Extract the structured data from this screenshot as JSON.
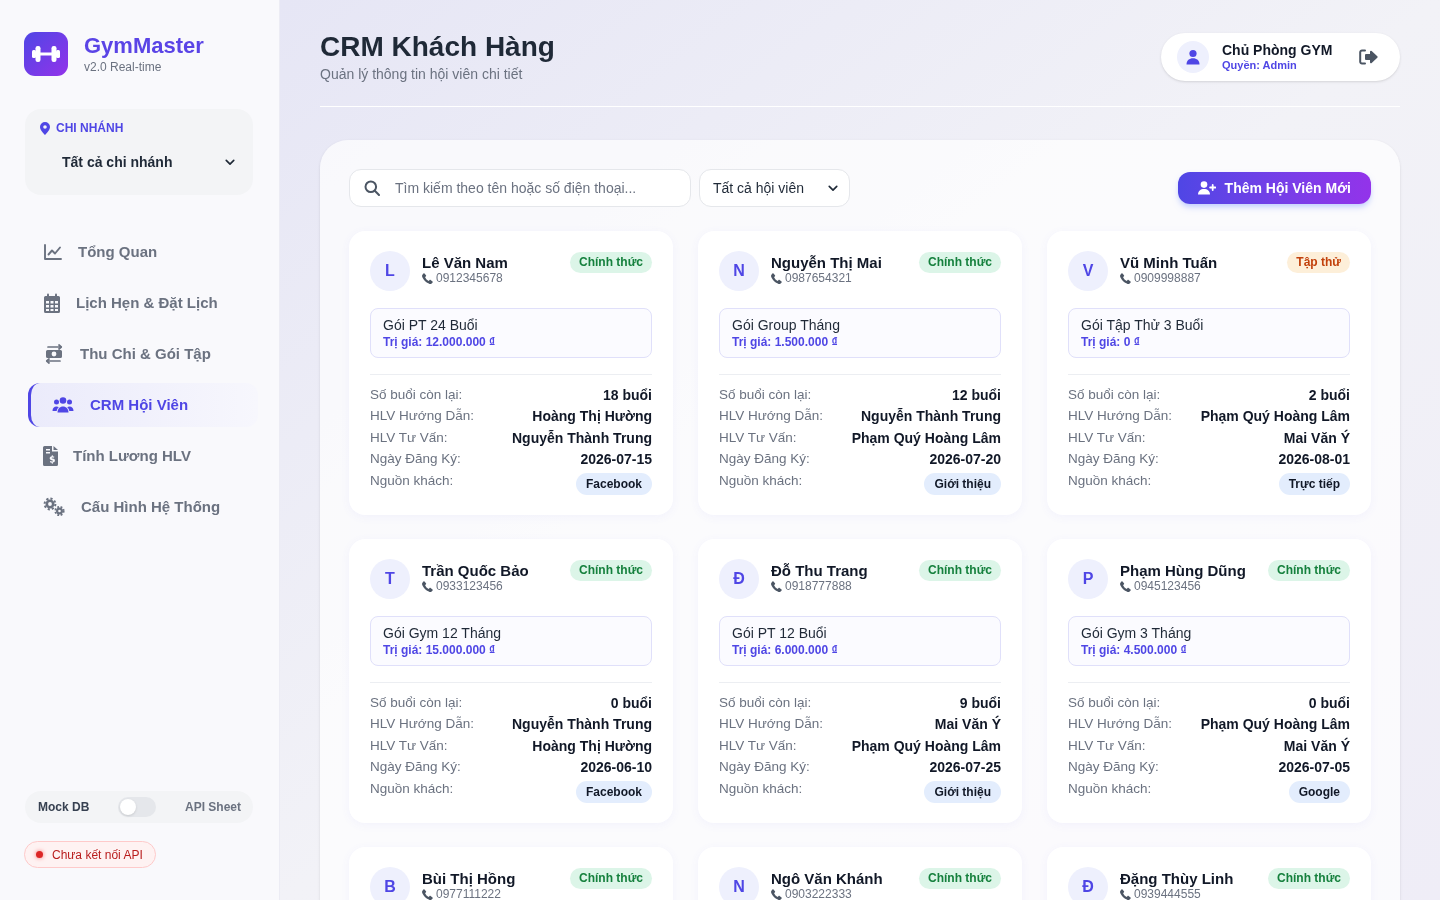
{
  "sidebar": {
    "logo": {
      "title": "GymMaster",
      "subtitle": "v2.0 Real-time"
    },
    "branch": {
      "label": "CHI NHÁNH",
      "value": "Tất cả chi nhánh"
    },
    "nav": [
      {
        "label": "Tổng Quan",
        "selected": false
      },
      {
        "label": "Lịch Hẹn & Đặt Lịch",
        "selected": false
      },
      {
        "label": "Thu Chi & Gói Tập",
        "selected": false
      },
      {
        "label": "CRM Hội Viên",
        "selected": true
      },
      {
        "label": "Tính Lương HLV",
        "selected": false
      },
      {
        "label": "Cấu Hình Hệ Thống",
        "selected": false
      }
    ],
    "data_source": {
      "left_label": "Mock DB",
      "right_label": "API Sheet",
      "on": false
    },
    "connection_status": "Chưa kết nối API"
  },
  "header": {
    "title": "CRM Khách Hàng",
    "subtitle": "Quản lý thông tin hội viên chi tiết",
    "user": {
      "name": "Chủ Phòng GYM",
      "role": "Quyền: Admin"
    }
  },
  "toolbar": {
    "search": {
      "placeholder": "Tìm kiếm theo tên hoặc số điện thoại..."
    },
    "filter": {
      "value": "Tất cả hội viên"
    },
    "add_button": "Thêm Hội Viên Mới"
  },
  "members": [
    {
      "initial": "L",
      "name": "Lê Văn Nam",
      "phone": "0912345678",
      "status": {
        "label": "Chính thức",
        "kind": "official"
      },
      "package": {
        "name": "Gói PT 24 Buổi",
        "price": "Trị giá: 12.000.000 ₫"
      },
      "details": [
        {
          "label": "Số buổi còn lại:",
          "value": "18 buổi"
        },
        {
          "label": "HLV Hướng Dẫn:",
          "value": "Hoàng Thị Hường"
        },
        {
          "label": "HLV Tư Vấn:",
          "value": "Nguyễn Thành Trung"
        },
        {
          "label": "Ngày Đăng Ký:",
          "value": "2026-07-15"
        }
      ],
      "source": {
        "label": "Nguồn khách:",
        "value": "Facebook"
      }
    },
    {
      "initial": "N",
      "name": "Nguyễn Thị Mai",
      "phone": "0987654321",
      "status": {
        "label": "Chính thức",
        "kind": "official"
      },
      "package": {
        "name": "Gói Group Tháng",
        "price": "Trị giá: 1.500.000 ₫"
      },
      "details": [
        {
          "label": "Số buổi còn lại:",
          "value": "12 buổi"
        },
        {
          "label": "HLV Hướng Dẫn:",
          "value": "Nguyễn Thành Trung"
        },
        {
          "label": "HLV Tư Vấn:",
          "value": "Phạm Quý Hoàng Lâm"
        },
        {
          "label": "Ngày Đăng Ký:",
          "value": "2026-07-20"
        }
      ],
      "source": {
        "label": "Nguồn khách:",
        "value": "Giới thiệu"
      }
    },
    {
      "initial": "V",
      "name": "Vũ Minh Tuấn",
      "phone": "0909998887",
      "status": {
        "label": "Tập thử",
        "kind": "trial"
      },
      "package": {
        "name": "Gói Tập Thử 3 Buổi",
        "price": "Trị giá: 0 ₫"
      },
      "details": [
        {
          "label": "Số buổi còn lại:",
          "value": "2 buổi"
        },
        {
          "label": "HLV Hướng Dẫn:",
          "value": "Phạm Quý Hoàng Lâm"
        },
        {
          "label": "HLV Tư Vấn:",
          "value": "Mai Văn Ý"
        },
        {
          "label": "Ngày Đăng Ký:",
          "value": "2026-08-01"
        }
      ],
      "source": {
        "label": "Nguồn khách:",
        "value": "Trực tiếp"
      }
    },
    {
      "initial": "T",
      "name": "Trần Quốc Bảo",
      "phone": "0933123456",
      "status": {
        "label": "Chính thức",
        "kind": "official"
      },
      "package": {
        "name": "Gói Gym 12 Tháng",
        "price": "Trị giá: 15.000.000 ₫"
      },
      "details": [
        {
          "label": "Số buổi còn lại:",
          "value": "0 buổi"
        },
        {
          "label": "HLV Hướng Dẫn:",
          "value": "Nguyễn Thành Trung"
        },
        {
          "label": "HLV Tư Vấn:",
          "value": "Hoàng Thị Hường"
        },
        {
          "label": "Ngày Đăng Ký:",
          "value": "2026-06-10"
        }
      ],
      "source": {
        "label": "Nguồn khách:",
        "value": "Facebook"
      }
    },
    {
      "initial": "Đ",
      "name": "Đỗ Thu Trang",
      "phone": "0918777888",
      "status": {
        "label": "Chính thức",
        "kind": "official"
      },
      "package": {
        "name": "Gói PT 12 Buổi",
        "price": "Trị giá: 6.000.000 ₫"
      },
      "details": [
        {
          "label": "Số buổi còn lại:",
          "value": "9 buổi"
        },
        {
          "label": "HLV Hướng Dẫn:",
          "value": "Mai Văn Ý"
        },
        {
          "label": "HLV Tư Vấn:",
          "value": "Phạm Quý Hoàng Lâm"
        },
        {
          "label": "Ngày Đăng Ký:",
          "value": "2026-07-25"
        }
      ],
      "source": {
        "label": "Nguồn khách:",
        "value": "Giới thiệu"
      }
    },
    {
      "initial": "P",
      "name": "Phạm Hùng Dũng",
      "phone": "0945123456",
      "status": {
        "label": "Chính thức",
        "kind": "official"
      },
      "package": {
        "name": "Gói Gym 3 Tháng",
        "price": "Trị giá: 4.500.000 ₫"
      },
      "details": [
        {
          "label": "Số buổi còn lại:",
          "value": "0 buổi"
        },
        {
          "label": "HLV Hướng Dẫn:",
          "value": "Phạm Quý Hoàng Lâm"
        },
        {
          "label": "HLV Tư Vấn:",
          "value": "Mai Văn Ý"
        },
        {
          "label": "Ngày Đăng Ký:",
          "value": "2026-07-05"
        }
      ],
      "source": {
        "label": "Nguồn khách:",
        "value": "Google"
      }
    },
    {
      "initial": "B",
      "name": "Bùi Thị Hồng",
      "phone": "0977111222",
      "status": {
        "label": "Chính thức",
        "kind": "official"
      }
    },
    {
      "initial": "N",
      "name": "Ngô Văn Khánh",
      "phone": "0903222333",
      "status": {
        "label": "Chính thức",
        "kind": "official"
      }
    },
    {
      "initial": "Đ",
      "name": "Đặng Thùy Linh",
      "phone": "0939444555",
      "status": {
        "label": "Chính thức",
        "kind": "official"
      }
    }
  ]
}
